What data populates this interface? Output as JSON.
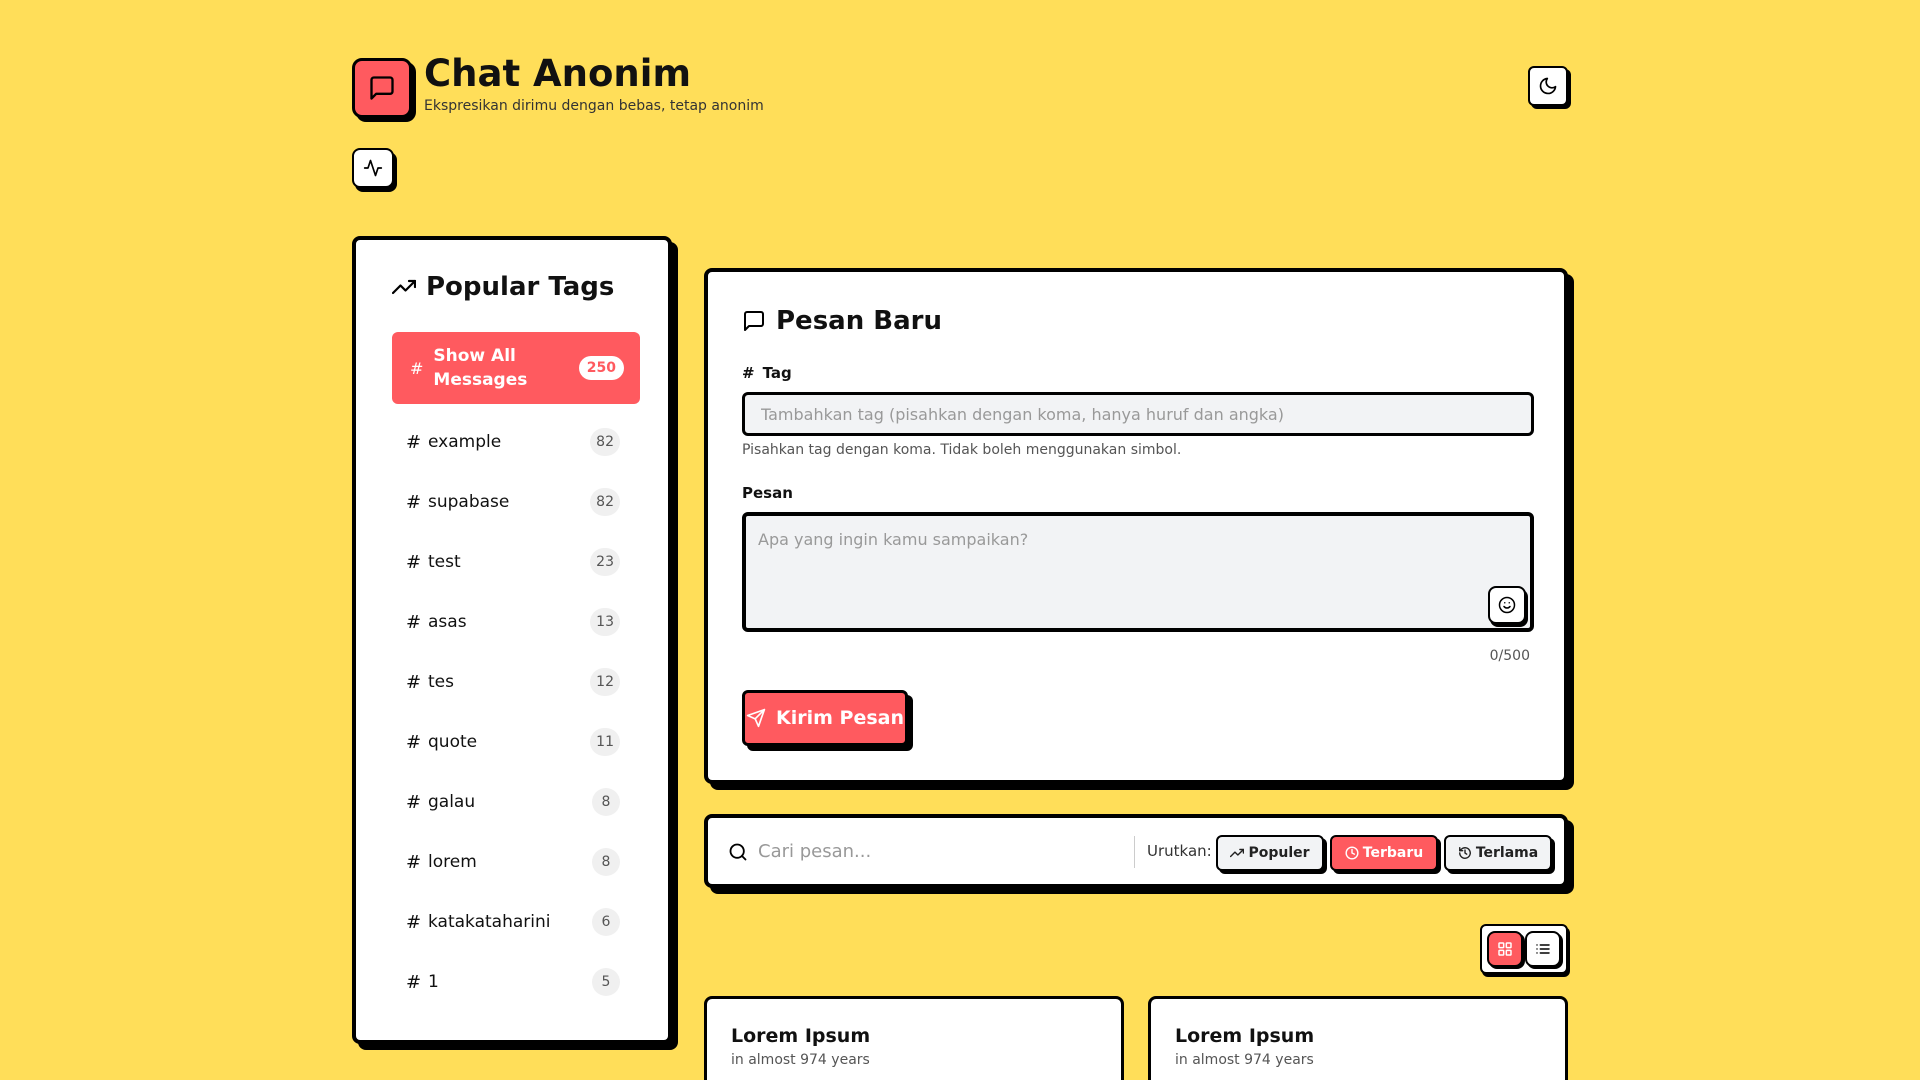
{
  "header": {
    "title": "Chat Anonim",
    "subtitle": "Ekspresikan dirimu dengan bebas, tetap anonim",
    "logo_icon": "message-square-icon",
    "theme_icon": "moon-icon",
    "activity_icon": "activity-icon"
  },
  "colors": {
    "background": "#FFDE59",
    "accent": "#FF5A5F",
    "card": "#FFFFFF",
    "border": "#000000"
  },
  "sidebar": {
    "heading": "Popular Tags",
    "heading_icon": "trending-up-icon",
    "all": {
      "hash": "#",
      "label": "Show All Messages",
      "count": "250"
    },
    "tags": [
      {
        "hash": "#",
        "name": "example",
        "count": "82"
      },
      {
        "hash": "#",
        "name": "supabase",
        "count": "82"
      },
      {
        "hash": "#",
        "name": "test",
        "count": "23"
      },
      {
        "hash": "#",
        "name": "asas",
        "count": "13"
      },
      {
        "hash": "#",
        "name": "tes",
        "count": "12"
      },
      {
        "hash": "#",
        "name": "quote",
        "count": "11"
      },
      {
        "hash": "#",
        "name": "galau",
        "count": "8"
      },
      {
        "hash": "#",
        "name": "lorem",
        "count": "8"
      },
      {
        "hash": "#",
        "name": "katakataharini",
        "count": "6"
      },
      {
        "hash": "#",
        "name": "1",
        "count": "5"
      }
    ]
  },
  "compose": {
    "heading": "Pesan Baru",
    "heading_icon": "message-square-icon",
    "tag_label": "Tag",
    "tag_hash": "#",
    "tag_placeholder": "Tambahkan tag (pisahkan dengan koma, hanya huruf dan angka)",
    "tag_value": "",
    "tag_help": "Pisahkan tag dengan koma. Tidak boleh menggunakan simbol.",
    "message_label": "Pesan",
    "message_placeholder": "Apa yang ingin kamu sampaikan?",
    "message_value": "",
    "emoji_icon": "smile-icon",
    "char_count": "0/500",
    "send_label": "Kirim Pesan",
    "send_icon": "send-icon"
  },
  "search": {
    "placeholder": "Cari pesan...",
    "value": "",
    "sort_label": "Urutkan:",
    "sort_options": [
      {
        "label": "Populer",
        "icon": "trending-up-icon",
        "active": false
      },
      {
        "label": "Terbaru",
        "icon": "clock-icon",
        "active": true
      },
      {
        "label": "Terlama",
        "icon": "history-icon",
        "active": false
      }
    ]
  },
  "view_toggle": {
    "grid_icon": "grid-icon",
    "list_icon": "list-icon",
    "active": "grid"
  },
  "messages": [
    {
      "title": "Lorem Ipsum",
      "time": "in almost 974 years"
    },
    {
      "title": "Lorem Ipsum",
      "time": "in almost 974 years"
    }
  ]
}
